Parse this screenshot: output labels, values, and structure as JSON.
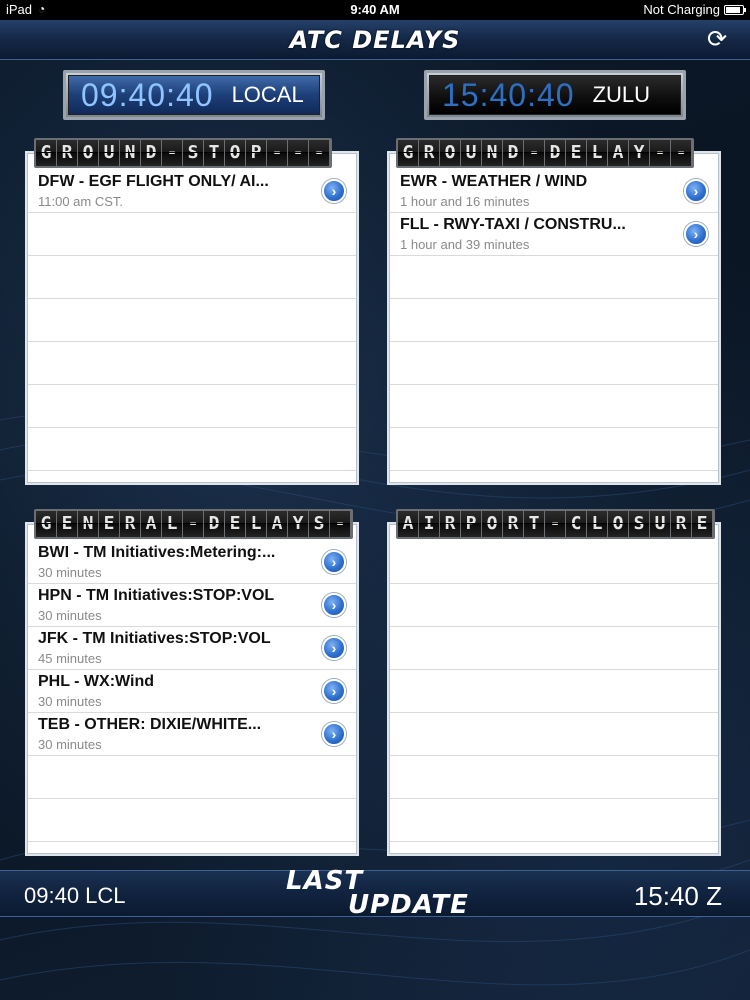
{
  "status_bar": {
    "carrier": "iPad",
    "time": "9:40 AM",
    "battery_status": "Not Charging",
    "wifi_icon": "wifi-icon",
    "battery_icon": "battery-icon"
  },
  "header": {
    "title": "ATC DELAYS",
    "refresh_icon": "refresh-icon"
  },
  "clocks": {
    "local": {
      "time": "09:40:40",
      "label": "LOCAL"
    },
    "zulu": {
      "time": "15:40:40",
      "label": "ZULU"
    }
  },
  "panels": [
    {
      "title_flaps": [
        "G",
        "R",
        "O",
        "U",
        "N",
        "D",
        "-",
        "S",
        "T",
        "O",
        "P",
        "-",
        "-",
        "-"
      ],
      "rows": [
        {
          "title": "DFW - EGF FLIGHT ONLY/ AI...",
          "sub": "11:00 am CST."
        }
      ],
      "empty_rows": 6
    },
    {
      "title_flaps": [
        "G",
        "R",
        "O",
        "U",
        "N",
        "D",
        "-",
        "D",
        "E",
        "L",
        "A",
        "Y",
        "-",
        "-"
      ],
      "rows": [
        {
          "title": "EWR - WEATHER / WIND",
          "sub": "1 hour and 16 minutes"
        },
        {
          "title": "FLL - RWY-TAXI / CONSTRU...",
          "sub": "1 hour and 39 minutes"
        }
      ],
      "empty_rows": 5
    },
    {
      "title_flaps": [
        "G",
        "E",
        "N",
        "E",
        "R",
        "A",
        "L",
        "-",
        "D",
        "E",
        "L",
        "A",
        "Y",
        "S",
        "-"
      ],
      "rows": [
        {
          "title": "BWI - TM Initiatives:Metering:...",
          "sub": "30 minutes"
        },
        {
          "title": "HPN - TM Initiatives:STOP:VOL",
          "sub": "30 minutes"
        },
        {
          "title": "JFK - TM Initiatives:STOP:VOL",
          "sub": "45 minutes"
        },
        {
          "title": "PHL - WX:Wind",
          "sub": "30 minutes"
        },
        {
          "title": "TEB - OTHER: DIXIE/WHITE...",
          "sub": "30 minutes"
        }
      ],
      "empty_rows": 2
    },
    {
      "title_flaps": [
        "A",
        "I",
        "R",
        "P",
        "O",
        "R",
        "T",
        "-",
        "C",
        "L",
        "O",
        "S",
        "U",
        "R",
        "E"
      ],
      "rows": [],
      "empty_rows": 7
    }
  ],
  "footer": {
    "local_time": "09:40 LCL",
    "zulu_time": "15:40 Z",
    "last_update_line1": "LAST",
    "last_update_line2": "UPDATE"
  },
  "colors": {
    "accent_blue": "#2f71d0",
    "bar_blue": "#142846"
  }
}
